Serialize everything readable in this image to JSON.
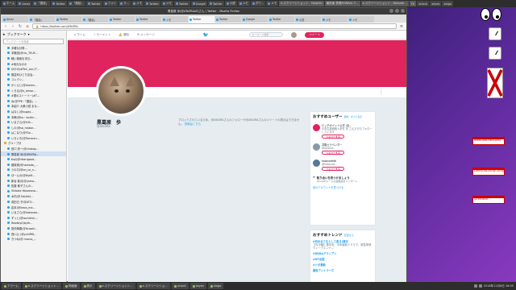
{
  "top_panel": {
    "tasks": [
      "ホーム",
      "Amaz",
      "「雑談」",
      "Twitter",
      "「雑談」",
      "Twitter",
      "フォト",
      "ラ…",
      "メモ",
      "Twitter",
      "メモ",
      "Twitter",
      "Google",
      "Twitter",
      "小説",
      "メモ",
      "ダウ…",
      "メモ"
    ],
    "win_tasks": [
      "e.スクリーンショット - Dolphin",
      "最前面 表現RONRAL T…",
      "e.スクリーンショット - Konsole…",
      "TX"
    ],
    "apps": [
      "xclock",
      "xeyes",
      "xlogo"
    ]
  },
  "browser": {
    "title": "黒葛原 歩(@ATeZRAkZ)さん | Twitter - Mozilla Firefox",
    "url": "https://twitter.com/ATeZRA",
    "tabs": [
      "Amaz",
      "「雑談」",
      "Twitter",
      "「雑談」",
      "Twitter",
      "Twitter",
      "メモ",
      "Twitter",
      "Twitter",
      "Google",
      "Twitter",
      "小説",
      "メモ",
      "メモ"
    ]
  },
  "sidebar": {
    "title": "ブックマーク",
    "search_placeholder": "ブックマークを検索",
    "items": [
      "手軽な計算…",
      "本集団(@mc_TEUE…",
      "軽い検索を本日…",
      "#地元なのか",
      "ほかの(#PeC_soc)ア…",
      "藤芸科ひとり自治…",
      "コレクシ…",
      "かくんじ(@ahemn…",
      "くろる(@s_lemar…",
      "#運のストーリー(#T…",
      "ね(@FPK・「雑談」…",
      "本紹介 大衆小説 まな…",
      "はなし(@sugay…",
      "本稿(@ka・tsukin…",
      "いまさら(@h3h…",
      "しの(@sa_mabor…",
      "はこなり(@FSa…",
      "いろいろ(@Tomanin…"
    ],
    "folder": "グループ分",
    "folder_items": [
      "田口 亮一(@chokap…",
      "黒葛原 歩(@ATeZRA…",
      "Kaji(@hikarigaod…",
      "藤原実(@hamada_…",
      "うの口(@on_co_n…",
      "ほーんの(@ttyk8…",
      "新谷 紫月(@yama…",
      "佐藤 郁子さんの…",
      "Shibata Yokomasa…",
      "木内(@ Ka(kat)…",
      "成田日 子(@ATO…",
      "岩本(@ikezo_ma…",
      "いまさら(@hakanaa…",
      "ずっと(@tachichin…",
      "ReadbyIQbyfe…",
      "田仲美春(@ikusaki…",
      "西川公 (@yuhiPIN…",
      "きつね(@ mocco_…"
    ]
  },
  "twitter": {
    "nav": {
      "home": "ホーム",
      "moments": "モーメント",
      "notifications": "通知",
      "messages": "メッセージ",
      "search_placeholder": "キーワード検索",
      "tweet_button": "ツイート"
    },
    "profile": {
      "name": "黒葛原　歩",
      "handle": "@ATeZRA",
      "blocked_text": "ブロックされているため、@ATeZRAさんのフォローや@ATeZRAさんのツイートの表示はできません。",
      "blocked_link": "詳細はこちら"
    },
    "who_to_follow": {
      "title": "おすすめユーザー",
      "update": "更新",
      "view_all": "すべて表示",
      "users": [
        {
          "name": "ピッチポイント公式 (全…",
          "sub": "小学生連続殺人事件 @ さんたちもフォローしています",
          "btn": "フォローする"
        },
        {
          "name": "井隆土ラベンダー",
          "sub": "@lavend…",
          "btn": "フォローする"
        },
        {
          "name": "katanadetti",
          "sub": "@katanad…",
          "btn": "フォローする"
        }
      ],
      "find_title": "知り合いを見つけましょう",
      "find_sub": "Gmailやメールの連絡先をインポート",
      "find_link": "他のアカウントを見つける"
    },
    "trends": {
      "title": "おすすめトレンド",
      "change": "変更する",
      "items": [
        {
          "tag": "#四中全て生として真る)湊河",
          "desc": "【今中継】湊中全、今年最新ドラマで、緊急事態ウィークエンド…"
        },
        {
          "tag": "#RRRAグランプリ",
          "desc": ""
        },
        {
          "tag": "#NT出国",
          "desc": ""
        },
        {
          "tag": "#ドボ最新",
          "desc": ""
        },
        {
          "tag": "最後アントラーズ",
          "desc": ""
        }
      ]
    }
  },
  "widgets": {
    "sticky_notes": [
      "tweet-add-reply-pro|",
      "t-entry-sq-2018y-2018|",
      "screenshot"
    ]
  },
  "bottom_panel": {
    "tasks": [
      "アラーム",
      "e.スクリーンショット…",
      "物画面",
      "表示",
      "e.スクリーンショット…",
      "e.スクリーンショ…",
      "xclock",
      "xeyes",
      "xlogo"
    ],
    "clock": "2018年11月8日 18:05"
  }
}
